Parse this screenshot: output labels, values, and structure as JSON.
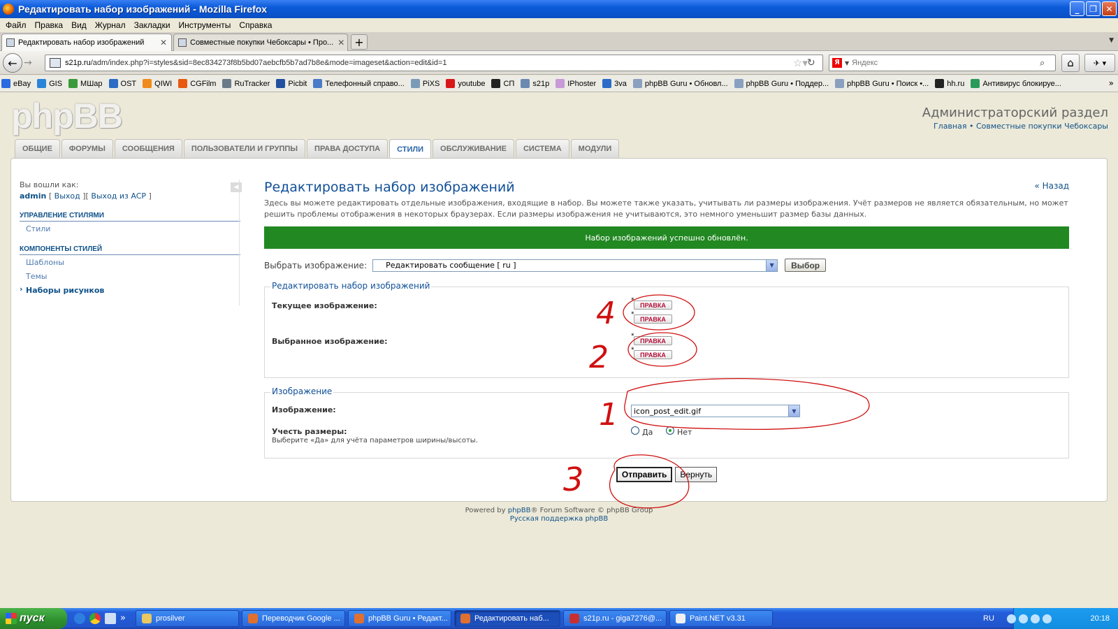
{
  "window": {
    "title": "Редактировать набор изображений - Mozilla Firefox"
  },
  "menubar": [
    "Файл",
    "Правка",
    "Вид",
    "Журнал",
    "Закладки",
    "Инструменты",
    "Справка"
  ],
  "tabs": [
    {
      "label": "Редактировать набор изображений",
      "active": true
    },
    {
      "label": "Совместные покупки Чебоксары • Про...",
      "active": false
    }
  ],
  "navbar": {
    "url_host": "s21p.ru",
    "url_path": "/adm/index.php?i=styles&sid=8ec834273f8b5bd07aebcfb5b7ad7b8e&mode=imageset&action=edit&id=1",
    "search_placeholder": "Яндекс"
  },
  "bookmarks": [
    {
      "label": "eBay",
      "color": "#2a6be0"
    },
    {
      "label": "GIS",
      "color": "#2a84d8"
    },
    {
      "label": "МШар",
      "color": "#3a9a3a"
    },
    {
      "label": "OST",
      "color": "#2b6cc4"
    },
    {
      "label": "QIWI",
      "color": "#f08a1a"
    },
    {
      "label": "CGFilm",
      "color": "#e85a10"
    },
    {
      "label": "RuTracker",
      "color": "#6a7a8a"
    },
    {
      "label": "Picbit",
      "color": "#2250a0"
    },
    {
      "label": "Телефонный справо...",
      "color": "#4a7ac8"
    },
    {
      "label": "PiXS",
      "color": "#7a9ab8"
    },
    {
      "label": "youtube",
      "color": "#d81818"
    },
    {
      "label": "СП",
      "color": "#222222"
    },
    {
      "label": "s21p",
      "color": "#6a8ab0"
    },
    {
      "label": "IPhoster",
      "color": "#c89ad8"
    },
    {
      "label": "3va",
      "color": "#2a6cc8"
    },
    {
      "label": "phpBB Guru • Обновл...",
      "color": "#8aa0c0"
    },
    {
      "label": "phpBB Guru • Поддер...",
      "color": "#8aa0c0"
    },
    {
      "label": "phpBB Guru • Поиск •...",
      "color": "#8aa0c0"
    },
    {
      "label": "hh.ru",
      "color": "#222222"
    },
    {
      "label": "Антивирус блокируе...",
      "color": "#2a9a5a"
    }
  ],
  "header": {
    "logo": "phpBB",
    "acp_title": "Администраторский раздел",
    "link_main": "Главная",
    "link_sep": " • ",
    "link_site": "Совместные покупки Чебоксары"
  },
  "nav_tabs": [
    {
      "label": "ОБЩИЕ",
      "active": false
    },
    {
      "label": "ФОРУМЫ",
      "active": false
    },
    {
      "label": "СООБЩЕНИЯ",
      "active": false
    },
    {
      "label": "ПОЛЬЗОВАТЕЛИ И ГРУППЫ",
      "active": false
    },
    {
      "label": "ПРАВА ДОСТУПА",
      "active": false
    },
    {
      "label": "СТИЛИ",
      "active": true
    },
    {
      "label": "ОБСЛУЖИВАНИЕ",
      "active": false
    },
    {
      "label": "СИСТЕМА",
      "active": false
    },
    {
      "label": "МОДУЛИ",
      "active": false
    }
  ],
  "sidebar": {
    "logged_as": "Вы вошли как:",
    "username": "admin",
    "logout": "Выход",
    "logout_acp": "Выход из ACP",
    "sections": [
      {
        "heading": "УПРАВЛЕНИЕ СТИЛЯМИ",
        "items": [
          {
            "label": "Стили",
            "current": false
          }
        ]
      },
      {
        "heading": "КОМПОНЕНТЫ СТИЛЕЙ",
        "items": [
          {
            "label": "Шаблоны",
            "current": false
          },
          {
            "label": "Темы",
            "current": false
          },
          {
            "label": "Наборы рисунков",
            "current": true
          }
        ]
      }
    ]
  },
  "main": {
    "title": "Редактировать набор изображений",
    "back": "« Назад",
    "description": "Здесь вы можете редактировать отдельные изображения, входящие в набор. Вы можете также указать, учитывать ли размеры изображения. Учёт размеров не является обязательным, но может решить проблемы отображения в некоторых браузерах. Если размеры изображения не учитываются, это немного уменьшит размер базы данных.",
    "success": "Набор изображений успешно обновлён.",
    "select_label": "Выбрать изображение:",
    "select_value": "Редактировать сообщение [ ru ]",
    "select_button": "Выбор",
    "fieldset1": {
      "legend": "Редактировать набор изображений",
      "current_label": "Текущее изображение:",
      "selected_label": "Выбранное изображение:",
      "badge": "ПРАВКА",
      "asterisk": "*"
    },
    "fieldset2": {
      "legend": "Изображение",
      "image_label": "Изображение:",
      "image_value": "icon_post_edit.gif",
      "size_label": "Учесть размеры:",
      "size_hint": "Выберите «Да» для учёта параметров ширины/высоты.",
      "yes": "Да",
      "no": "Нет",
      "selected": "no"
    },
    "submit": "Отправить",
    "reset": "Вернуть"
  },
  "footer": {
    "powered_prefix": "Powered by ",
    "powered_link": "phpBB",
    "powered_suffix": "® Forum Software © phpBB Group",
    "support": "Русская поддержка phpBB"
  },
  "annotations": [
    "1",
    "2",
    "3",
    "4"
  ],
  "taskbar": {
    "start": "пуск",
    "tasks": [
      {
        "label": "prosilver",
        "color": "#e8c860",
        "active": false
      },
      {
        "label": "Переводчик Google ...",
        "color": "#e07030",
        "active": false
      },
      {
        "label": "phpBB Guru • Редакт...",
        "color": "#e07030",
        "active": false
      },
      {
        "label": "Редактировать наб...",
        "color": "#e07030",
        "active": true
      },
      {
        "label": "s21p.ru - giga7276@...",
        "color": "#c83030",
        "active": false
      },
      {
        "label": "Paint.NET v3.31",
        "color": "#f0f0f0",
        "active": false
      }
    ],
    "lang": "RU",
    "clock": "20:18"
  }
}
